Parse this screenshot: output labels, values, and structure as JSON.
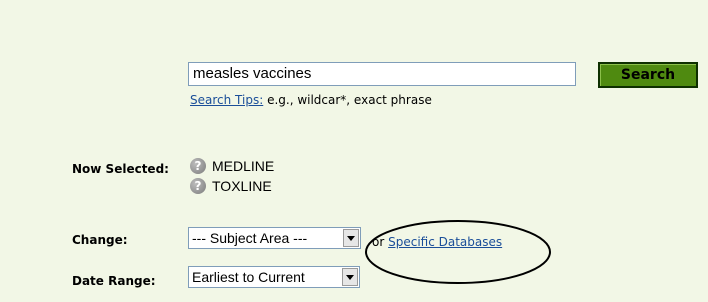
{
  "search": {
    "query_value": "measles vaccines",
    "button_label": "Search",
    "tips_link": "Search Tips:",
    "tips_text": " e.g., wildcar*, exact phrase"
  },
  "selected": {
    "label": "Now Selected:",
    "databases": [
      "MEDLINE",
      "TOXLINE"
    ],
    "icon": "question-mark-icon"
  },
  "change": {
    "label": "Change:",
    "select_value": "--- Subject Area ---",
    "or_text": "or",
    "link": "Specific Databases"
  },
  "date_range": {
    "label": "Date Range:",
    "select_value": "Earliest to Current"
  },
  "colors": {
    "panel_bg": "#f2f7e6",
    "search_button": "#4f8a10",
    "link": "#1a4e99"
  }
}
